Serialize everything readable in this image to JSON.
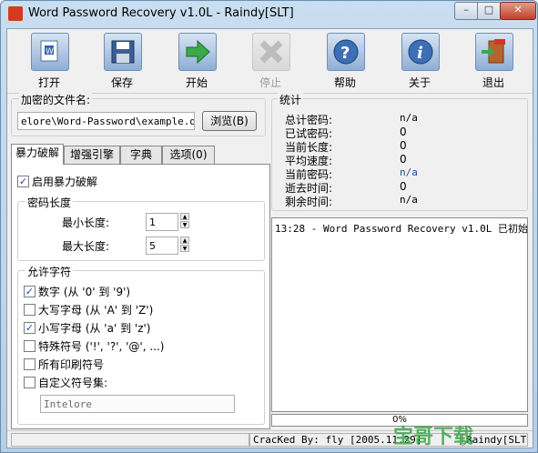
{
  "window": {
    "title": "Word Password Recovery v1.0L - Raindy[SLT]"
  },
  "toolbar": {
    "open": "打开",
    "save": "保存",
    "start": "开始",
    "stop": "停止",
    "help": "帮助",
    "about": "关于",
    "exit": "退出"
  },
  "file_group": {
    "label": "加密的文件名:",
    "value": "elore\\Word-Password\\example.doc",
    "browse": "浏览(B)"
  },
  "tabs": [
    "暴力破解",
    "增强引擎",
    "字典",
    "选项(0)"
  ],
  "brute": {
    "enable": "启用暴力破解",
    "length_group": "密码长度",
    "min_label": "最小长度:",
    "min_value": "1",
    "max_label": "最大长度:",
    "max_value": "5",
    "charset_group": "允许字符",
    "options": [
      {
        "label": "数字 (从 '0' 到 '9')",
        "checked": true
      },
      {
        "label": "大写字母 (从 'A' 到 'Z')",
        "checked": false
      },
      {
        "label": "小写字母 (从 'a' 到 'z')",
        "checked": true
      },
      {
        "label": "特殊符号 ('!', '?', '@', ...)",
        "checked": false
      },
      {
        "label": "所有印刷符号",
        "checked": false
      },
      {
        "label": "自定义符号集:",
        "checked": false
      }
    ],
    "custom_value": "Intelore"
  },
  "stats": {
    "label": "统计",
    "rows": [
      {
        "label": "总计密码:",
        "value": "n/a"
      },
      {
        "label": "已试密码:",
        "value": "0"
      },
      {
        "label": "当前长度:",
        "value": "0"
      },
      {
        "label": "平均速度:",
        "value": "0"
      },
      {
        "label": "当前密码:",
        "value": "n/a"
      },
      {
        "label": "逝去时间:",
        "value": "0"
      },
      {
        "label": "剩余时间:",
        "value": "n/a"
      }
    ]
  },
  "log": {
    "line1": "13:28 - Word Password Recovery v1.0L 已初始"
  },
  "progress": {
    "text": "0%",
    "fraction": 0
  },
  "statusbar": {
    "cracked": "CracKed By: fly [2005.11.29]",
    "author": "Raindy[SLT]"
  },
  "watermark": "宝哥下载",
  "colors": {
    "title_bg": "#c9def0",
    "accent_value": "#1b4f9b",
    "watermark": "#3aa64a"
  }
}
